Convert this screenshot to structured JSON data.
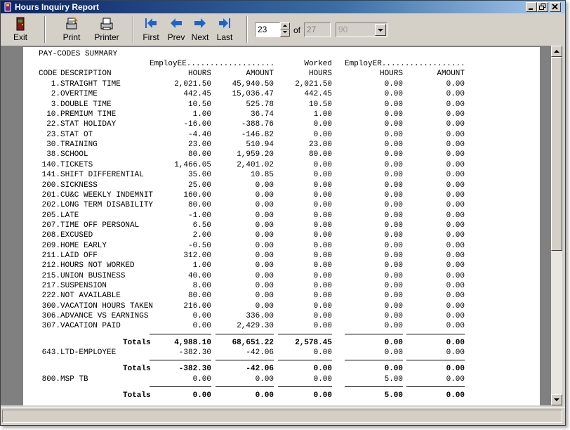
{
  "window": {
    "title": "Hours Inquiry Report"
  },
  "toolbar": {
    "exit_label": "Exit",
    "print_label": "Print",
    "printer_label": "Printer",
    "first_label": "First",
    "prev_label": "Prev",
    "next_label": "Next",
    "last_label": "Last",
    "page_value": "23",
    "of_label": "of",
    "total_pages": "27",
    "zoom_value": "90"
  },
  "icons": {
    "exit": "exit-door-icon",
    "print": "print-icon",
    "printer": "printer-setup-icon",
    "first": "first-page-icon",
    "prev": "prev-page-icon",
    "next": "next-page-icon",
    "last": "last-page-icon"
  },
  "colors": {
    "titlebar_start": "#0a246a",
    "titlebar_end": "#a6caf0",
    "nav_icon": "#1e64c8",
    "window_bg": "#d4d0c8"
  },
  "report": {
    "section_title": "PAY-CODES SUMMARY",
    "group_employee": "EmployEE...................",
    "group_worked": "Worked",
    "group_employer": "EmployER..................",
    "col_code": "CODE",
    "col_description": "DESCRIPTION",
    "col_hours": "HOURS",
    "col_amount": "AMOUNT",
    "rows": [
      {
        "code": "1.",
        "desc": "STRAIGHT TIME",
        "ee_hours": "2,021.50",
        "ee_amount": "45,940.50",
        "worked": "2,021.50",
        "er_hours": "0.00",
        "er_amount": "0.00"
      },
      {
        "code": "2.",
        "desc": "OVERTIME",
        "ee_hours": "442.45",
        "ee_amount": "15,036.47",
        "worked": "442.45",
        "er_hours": "0.00",
        "er_amount": "0.00"
      },
      {
        "code": "3.",
        "desc": "DOUBLE TIME",
        "ee_hours": "10.50",
        "ee_amount": "525.78",
        "worked": "10.50",
        "er_hours": "0.00",
        "er_amount": "0.00"
      },
      {
        "code": "10.",
        "desc": "PREMIUM TIME",
        "ee_hours": "1.00",
        "ee_amount": "36.74",
        "worked": "1.00",
        "er_hours": "0.00",
        "er_amount": "0.00"
      },
      {
        "code": "22.",
        "desc": "STAT HOLIDAY",
        "ee_hours": "-16.00",
        "ee_amount": "-388.76",
        "worked": "0.00",
        "er_hours": "0.00",
        "er_amount": "0.00"
      },
      {
        "code": "23.",
        "desc": "STAT OT",
        "ee_hours": "-4.40",
        "ee_amount": "-146.82",
        "worked": "0.00",
        "er_hours": "0.00",
        "er_amount": "0.00"
      },
      {
        "code": "30.",
        "desc": "TRAINING",
        "ee_hours": "23.00",
        "ee_amount": "510.94",
        "worked": "23.00",
        "er_hours": "0.00",
        "er_amount": "0.00"
      },
      {
        "code": "38.",
        "desc": "SCHOOL",
        "ee_hours": "80.00",
        "ee_amount": "1,959.20",
        "worked": "80.00",
        "er_hours": "0.00",
        "er_amount": "0.00"
      },
      {
        "code": "140.",
        "desc": "TICKETS",
        "ee_hours": "1,466.05",
        "ee_amount": "2,401.02",
        "worked": "0.00",
        "er_hours": "0.00",
        "er_amount": "0.00"
      },
      {
        "code": "141.",
        "desc": "SHIFT DIFFERENTIAL",
        "ee_hours": "35.00",
        "ee_amount": "10.85",
        "worked": "0.00",
        "er_hours": "0.00",
        "er_amount": "0.00"
      },
      {
        "code": "200.",
        "desc": "SICKNESS",
        "ee_hours": "25.00",
        "ee_amount": "0.00",
        "worked": "0.00",
        "er_hours": "0.00",
        "er_amount": "0.00"
      },
      {
        "code": "201.",
        "desc": "CU&C WEEKLY INDEMNIT",
        "ee_hours": "160.00",
        "ee_amount": "0.00",
        "worked": "0.00",
        "er_hours": "0.00",
        "er_amount": "0.00"
      },
      {
        "code": "202.",
        "desc": "LONG TERM DISABILITY",
        "ee_hours": "80.00",
        "ee_amount": "0.00",
        "worked": "0.00",
        "er_hours": "0.00",
        "er_amount": "0.00"
      },
      {
        "code": "205.",
        "desc": "LATE",
        "ee_hours": "-1.00",
        "ee_amount": "0.00",
        "worked": "0.00",
        "er_hours": "0.00",
        "er_amount": "0.00"
      },
      {
        "code": "207.",
        "desc": "TIME OFF PERSONAL",
        "ee_hours": "6.50",
        "ee_amount": "0.00",
        "worked": "0.00",
        "er_hours": "0.00",
        "er_amount": "0.00"
      },
      {
        "code": "208.",
        "desc": "EXCUSED",
        "ee_hours": "2.00",
        "ee_amount": "0.00",
        "worked": "0.00",
        "er_hours": "0.00",
        "er_amount": "0.00"
      },
      {
        "code": "209.",
        "desc": "HOME EARLY",
        "ee_hours": "-0.50",
        "ee_amount": "0.00",
        "worked": "0.00",
        "er_hours": "0.00",
        "er_amount": "0.00"
      },
      {
        "code": "211.",
        "desc": "LAID OFF",
        "ee_hours": "312.00",
        "ee_amount": "0.00",
        "worked": "0.00",
        "er_hours": "0.00",
        "er_amount": "0.00"
      },
      {
        "code": "212.",
        "desc": "HOURS NOT WORKED",
        "ee_hours": "1.00",
        "ee_amount": "0.00",
        "worked": "0.00",
        "er_hours": "0.00",
        "er_amount": "0.00"
      },
      {
        "code": "215.",
        "desc": "UNION BUSINESS",
        "ee_hours": "40.00",
        "ee_amount": "0.00",
        "worked": "0.00",
        "er_hours": "0.00",
        "er_amount": "0.00"
      },
      {
        "code": "217.",
        "desc": "SUSPENSION",
        "ee_hours": "8.00",
        "ee_amount": "0.00",
        "worked": "0.00",
        "er_hours": "0.00",
        "er_amount": "0.00"
      },
      {
        "code": "222.",
        "desc": "NOT AVAILABLE",
        "ee_hours": "80.00",
        "ee_amount": "0.00",
        "worked": "0.00",
        "er_hours": "0.00",
        "er_amount": "0.00"
      },
      {
        "code": "300.",
        "desc": "VACATION HOURS TAKEN",
        "ee_hours": "216.00",
        "ee_amount": "0.00",
        "worked": "0.00",
        "er_hours": "0.00",
        "er_amount": "0.00"
      },
      {
        "code": "306.",
        "desc": "ADVANCE VS EARNINGS",
        "ee_hours": "0.00",
        "ee_amount": "336.00",
        "worked": "0.00",
        "er_hours": "0.00",
        "er_amount": "0.00"
      },
      {
        "code": "307.",
        "desc": "VACATION PAID",
        "ee_hours": "0.00",
        "ee_amount": "2,429.30",
        "worked": "0.00",
        "er_hours": "0.00",
        "er_amount": "0.00"
      }
    ],
    "groups": [
      {
        "totals_label": "Totals",
        "totals": [
          "4,988.10",
          "68,651.22",
          "2,578.45",
          "0.00",
          "0.00"
        ],
        "extra": {
          "code": "643.",
          "desc": "LTD-EMPLOYEE",
          "values": [
            "-382.30",
            "-42.06",
            "0.00",
            "0.00",
            "0.00"
          ]
        }
      },
      {
        "totals_label": "Totals",
        "totals": [
          "-382.30",
          "-42.06",
          "0.00",
          "0.00",
          "0.00"
        ],
        "extra": {
          "code": "800.",
          "desc": "MSP TB",
          "values": [
            "0.00",
            "0.00",
            "0.00",
            "5.00",
            "0.00"
          ]
        }
      },
      {
        "totals_label": "Totals",
        "totals": [
          "0.00",
          "0.00",
          "0.00",
          "5.00",
          "0.00"
        ]
      }
    ]
  },
  "statusbar": {
    "text": ""
  }
}
